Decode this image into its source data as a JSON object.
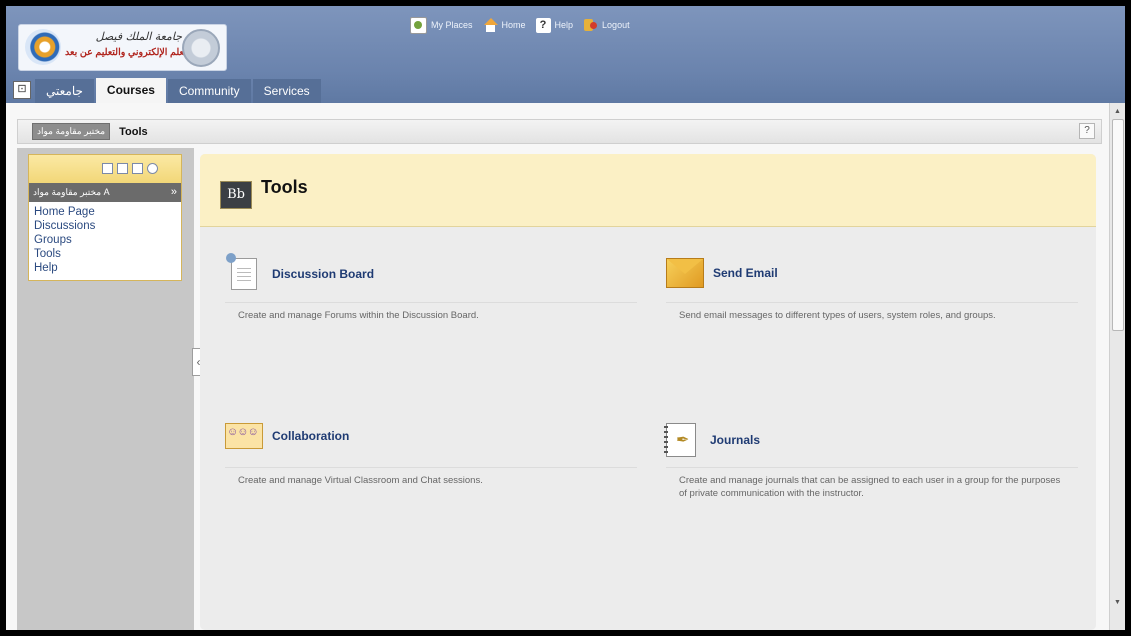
{
  "logo": {
    "line1": "جامعة الملك فيصل",
    "line2": "عمادة التعلم الإلكتروني والتعليم عن بعد"
  },
  "top_links": [
    {
      "label": "My Places",
      "icon": "my-places-icon"
    },
    {
      "label": "Home",
      "icon": "home-icon"
    },
    {
      "label": "Help",
      "icon": "help-icon"
    },
    {
      "label": "Logout",
      "icon": "logout-icon"
    }
  ],
  "tabs": [
    {
      "label": "جامعتي",
      "state": "normal"
    },
    {
      "label": "Courses",
      "state": "active"
    },
    {
      "label": "Community",
      "state": "normal"
    },
    {
      "label": "Services",
      "state": "normal"
    }
  ],
  "breadcrumb": {
    "course": "مختبر مقاومة مواد",
    "page": "Tools",
    "help": "?"
  },
  "course_menu": {
    "header": "مختبر مقاومة مواد A",
    "collapse": "»",
    "items": [
      "Home Page",
      "Discussions",
      "Groups",
      "Tools",
      "Help"
    ]
  },
  "collapse_handle": "‹",
  "main": {
    "title": "Tools",
    "bb_icon": "Bb",
    "tools": [
      {
        "title": "Discussion Board",
        "description": "Create and manage Forums within the Discussion Board.",
        "icon": "discussion-board-icon"
      },
      {
        "title": "Send Email",
        "description": "Send email messages to different types of users, system roles, and groups.",
        "icon": "send-email-icon"
      },
      {
        "title": "Collaboration",
        "description": "Create and manage Virtual Classroom and Chat sessions.",
        "icon": "collaboration-icon"
      },
      {
        "title": "Journals",
        "description": "Create and manage journals that can be assigned to each user in a group for the purposes of private communication with the instructor.",
        "icon": "journals-icon"
      }
    ]
  },
  "colors": {
    "header_blue": "#6a83ad",
    "title_bar": "#fbf0c5",
    "link_blue": "#1f3b73"
  }
}
